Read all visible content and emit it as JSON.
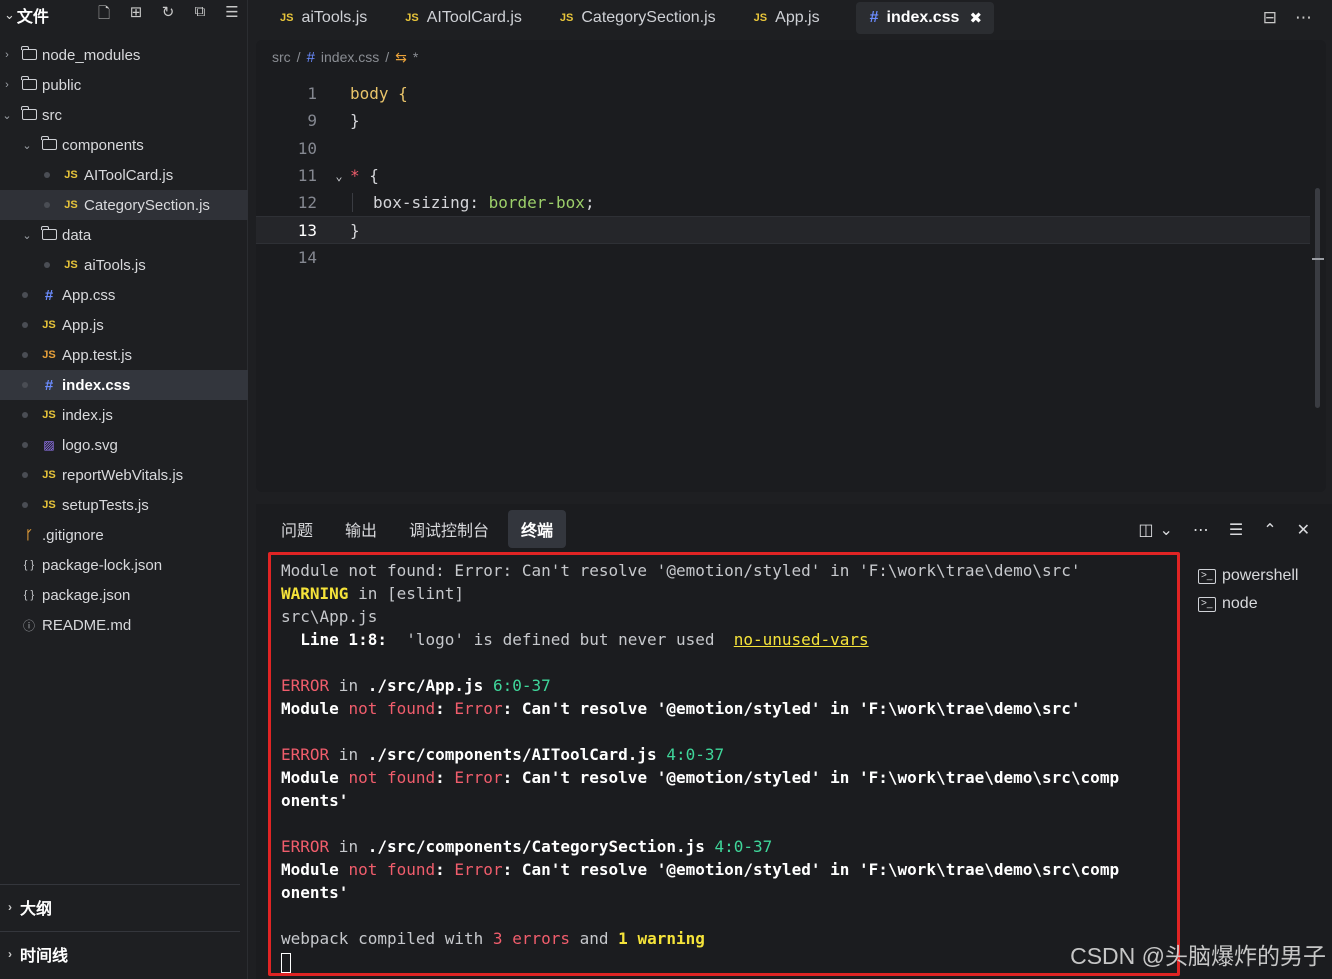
{
  "sidebar": {
    "title": "文件",
    "tree": [
      {
        "label": "node_modules",
        "type": "folder",
        "arrow": "›"
      },
      {
        "label": "public",
        "type": "folder",
        "arrow": "›"
      },
      {
        "label": "src",
        "type": "folder",
        "arrow": "⌄"
      },
      {
        "label": "components",
        "type": "folder",
        "arrow": "⌄"
      },
      {
        "label": "AIToolCard.js",
        "type": "js"
      },
      {
        "label": "CategorySection.js",
        "type": "js"
      },
      {
        "label": "data",
        "type": "folder",
        "arrow": "⌄"
      },
      {
        "label": "aiTools.js",
        "type": "js"
      },
      {
        "label": "App.css",
        "type": "css"
      },
      {
        "label": "App.js",
        "type": "js"
      },
      {
        "label": "App.test.js",
        "type": "js"
      },
      {
        "label": "index.css",
        "type": "css"
      },
      {
        "label": "index.js",
        "type": "js"
      },
      {
        "label": "logo.svg",
        "type": "svg"
      },
      {
        "label": "reportWebVitals.js",
        "type": "js"
      },
      {
        "label": "setupTests.js",
        "type": "js"
      },
      {
        "label": ".gitignore",
        "type": "git"
      },
      {
        "label": "package-lock.json",
        "type": "json"
      },
      {
        "label": "package.json",
        "type": "json"
      },
      {
        "label": "README.md",
        "type": "info"
      }
    ],
    "outline": "大纲",
    "timeline": "时间线"
  },
  "tabs": [
    {
      "label": "aiTools.js",
      "icon": "JS"
    },
    {
      "label": "AIToolCard.js",
      "icon": "JS"
    },
    {
      "label": "CategorySection.js",
      "icon": "JS"
    },
    {
      "label": "App.js",
      "icon": "JS"
    },
    {
      "label": "index.css",
      "icon": "#",
      "active": true
    }
  ],
  "breadcrumb": {
    "root": "src",
    "sep": "/",
    "file": "index.css",
    "symbol": "*"
  },
  "code": {
    "lines": [
      {
        "n": "1",
        "text": "body {"
      },
      {
        "n": "9",
        "text": "}"
      },
      {
        "n": "10",
        "text": ""
      },
      {
        "n": "11",
        "text": "* {"
      },
      {
        "n": "12",
        "text": "box-sizing: border-box;"
      },
      {
        "n": "13",
        "text": "}"
      },
      {
        "n": "14",
        "text": ""
      }
    ]
  },
  "panel": {
    "tabs": [
      "问题",
      "输出",
      "调试控制台",
      "终端"
    ],
    "active_tab": "终端",
    "shells": [
      "powershell",
      "node"
    ]
  },
  "terminal": {
    "l1": "Module not found: Error: Can't resolve '@emotion/styled' in 'F:\\work\\trae\\demo\\src'",
    "warning_word": "WARNING",
    "l2_rest": " in [eslint]",
    "l3": "src\\App.js",
    "l4_line": "  Line 1:8:",
    "l4_msg": "  'logo' is defined but never used  ",
    "l4_rule": "no-unused-vars",
    "error_word": "ERROR",
    "in_word": " in ",
    "e1_path": "./src/App.js",
    "e1_pos": "6:0-37",
    "e2_path": "./src/components/AIToolCard.js",
    "e2_pos": "4:0-37",
    "e3_path": "./src/components/CategorySection.js",
    "e3_pos": "4:0-37",
    "mod_module": "Module ",
    "mod_not_found": "not found",
    "mod_colon": ": ",
    "mod_error": "Error",
    "mod_rest_src": ": Can't resolve '@emotion/styled' in 'F:\\work\\trae\\demo\\src'",
    "mod_rest_comp": ": Can't resolve '@emotion/styled' in 'F:\\work\\trae\\demo\\src\\comp",
    "wrap_tail": "onents'",
    "summary_a": "webpack compiled with ",
    "summary_n1": "3",
    "summary_errors": " errors",
    "summary_b": " and ",
    "summary_n2": "1",
    "summary_warning": " warning"
  },
  "watermark": "CSDN @头脑爆炸的男子",
  "colors": {
    "error": "#f05d6c",
    "warning": "#f5e33a",
    "position": "#3fd69a",
    "highlight_border": "#e02424"
  }
}
